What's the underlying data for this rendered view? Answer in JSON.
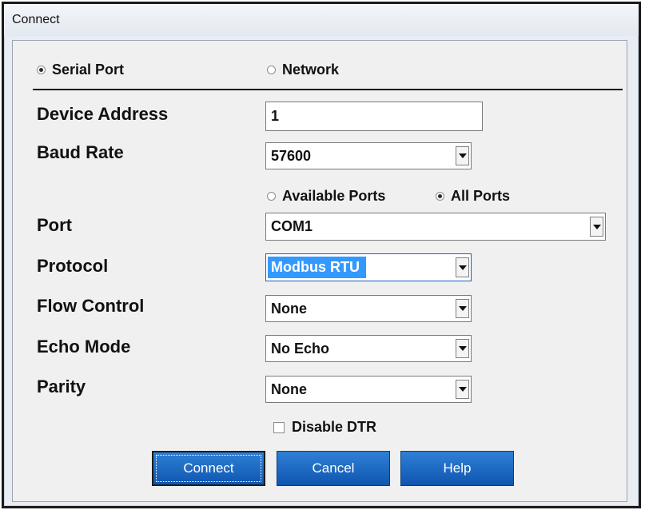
{
  "window": {
    "title": "Connect"
  },
  "connection_type": {
    "options": [
      "Serial Port",
      "Network"
    ],
    "selected": "Serial Port"
  },
  "device_address": {
    "label": "Device Address",
    "value": "1"
  },
  "baud_rate": {
    "label": "Baud Rate",
    "value": "57600"
  },
  "port_filter": {
    "options": [
      "Available Ports",
      "All Ports"
    ],
    "selected": "All Ports"
  },
  "port": {
    "label": "Port",
    "value": "COM1"
  },
  "protocol": {
    "label": "Protocol",
    "value": "Modbus RTU"
  },
  "flow_control": {
    "label": "Flow Control",
    "value": "None"
  },
  "echo_mode": {
    "label": "Echo Mode",
    "value": "No Echo"
  },
  "parity": {
    "label": "Parity",
    "value": "None"
  },
  "disable_dtr": {
    "label": "Disable DTR",
    "checked": false
  },
  "buttons": {
    "connect": "Connect",
    "cancel": "Cancel",
    "help": "Help"
  },
  "colors": {
    "accent": "#1565c0",
    "selection": "#3399ff",
    "background": "#f0f0f0"
  }
}
